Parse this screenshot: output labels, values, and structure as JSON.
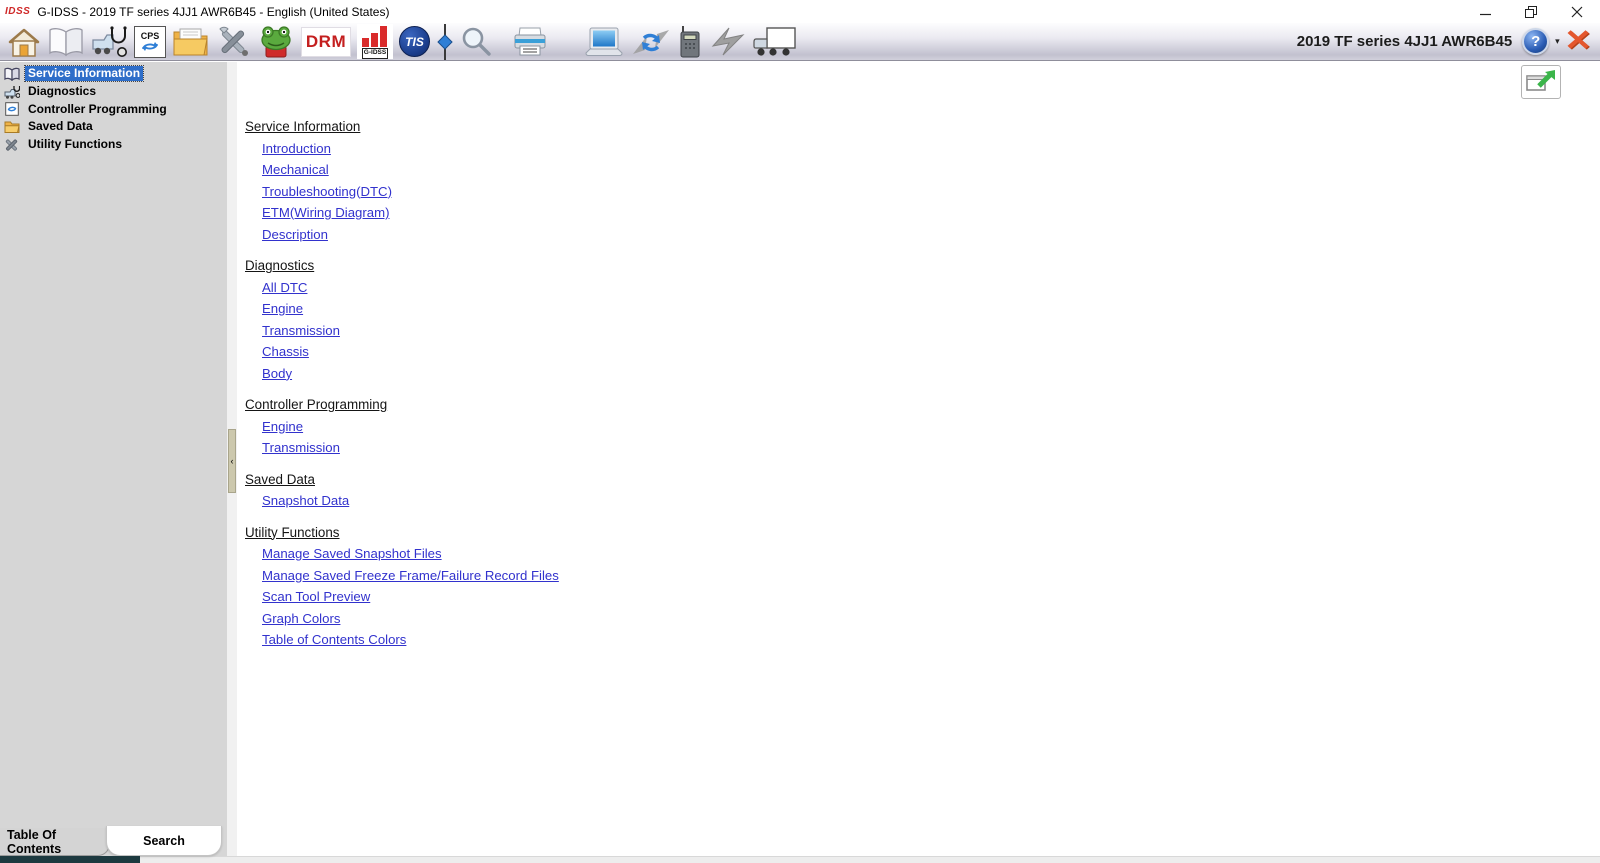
{
  "window": {
    "logo": "IDSS",
    "title": "G-IDSS - 2019 TF series 4JJ1 AWR6B45 - English (United States)"
  },
  "toolbar": {
    "vehicle_label": "2019 TF series 4JJ1 AWR6B45",
    "help_label": "?",
    "cps_label": "CPS",
    "drm_label": "DRM",
    "gidss_label": "G-IDSS",
    "tis_label": "TIS",
    "icon_names": [
      "home-icon",
      "manuals-book-icon",
      "vehicle-diagnostics-icon",
      "cps-programming-icon",
      "saved-data-folder-icon",
      "utility-tools-icon",
      "frog-icon",
      "drm-icon",
      "gidss-report-chart-icon",
      "tis-icon",
      "connector-icon",
      "search-icon",
      "print-icon",
      "laptop-icon",
      "sync-icon",
      "radio-icon",
      "flash-reprogram-icon",
      "truck-icon",
      "help-icon",
      "close-session-icon",
      "popout-icon"
    ]
  },
  "sidebar": {
    "items": [
      {
        "label": "Service Information",
        "icon": "book-icon",
        "selected": true
      },
      {
        "label": "Diagnostics",
        "icon": "diagnostics-icon",
        "selected": false
      },
      {
        "label": "Controller Programming",
        "icon": "cps-icon",
        "selected": false
      },
      {
        "label": "Saved Data",
        "icon": "folder-icon",
        "selected": false
      },
      {
        "label": "Utility Functions",
        "icon": "tools-icon",
        "selected": false
      }
    ],
    "tabs": [
      {
        "label": "Table Of Contents",
        "active": true
      },
      {
        "label": "Search",
        "active": false
      }
    ]
  },
  "content": {
    "sections": [
      {
        "title": "Service Information",
        "links": [
          "Introduction",
          "Mechanical",
          "Troubleshooting(DTC)",
          "ETM(Wiring Diagram)",
          "Description"
        ]
      },
      {
        "title": "Diagnostics",
        "links": [
          "All DTC",
          "Engine",
          "Transmission",
          "Chassis",
          "Body"
        ]
      },
      {
        "title": "Controller Programming",
        "links": [
          "Engine",
          "Transmission"
        ]
      },
      {
        "title": "Saved Data",
        "links": [
          "Snapshot Data"
        ]
      },
      {
        "title": "Utility Functions",
        "links": [
          "Manage Saved Snapshot Files",
          "Manage Saved Freeze Frame/Failure Record Files",
          "Scan Tool Preview",
          "Graph Colors",
          "Table of Contents Colors"
        ]
      }
    ]
  },
  "colors": {
    "selection_bg": "#2e6ec9",
    "link_blue": "#3232cd",
    "sidebar_bg": "#d6d6d6",
    "close_orange": "#e4572e",
    "toolbar_gradient_bottom": "#c2c1cf"
  }
}
